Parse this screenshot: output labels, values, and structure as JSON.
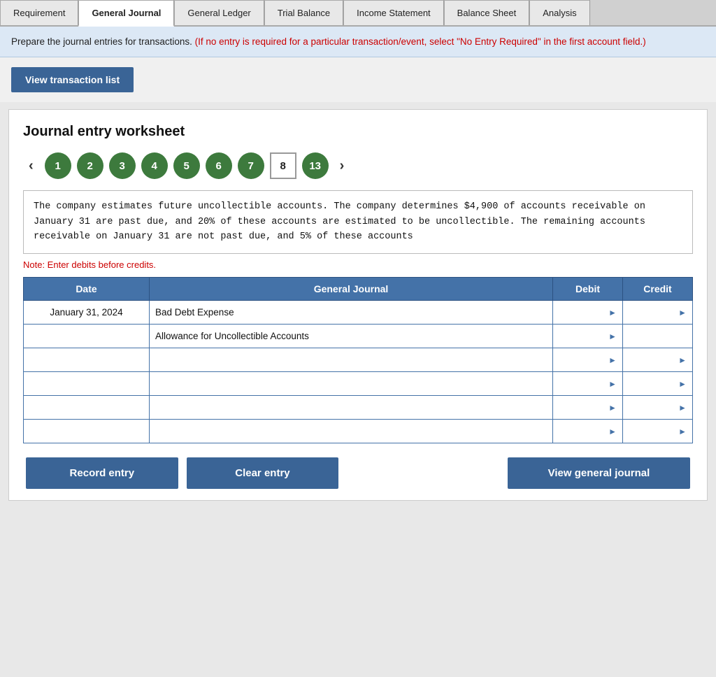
{
  "tabs": [
    {
      "id": "requirement",
      "label": "Requirement",
      "active": false
    },
    {
      "id": "general-journal",
      "label": "General\nJournal",
      "active": true
    },
    {
      "id": "general-ledger",
      "label": "General\nLedger",
      "active": false
    },
    {
      "id": "trial-balance",
      "label": "Trial Balance",
      "active": false
    },
    {
      "id": "income-statement",
      "label": "Income\nStatement",
      "active": false
    },
    {
      "id": "balance-sheet",
      "label": "Balance Sheet",
      "active": false
    },
    {
      "id": "analysis",
      "label": "Analysis",
      "active": false
    }
  ],
  "instruction": {
    "main": "Prepare the journal entries for transactions.",
    "red": " (If no entry is required for a particular transaction/event, select \"No Entry Required\" in the first account field.)"
  },
  "view_transaction_button": "View transaction list",
  "worksheet": {
    "title": "Journal entry worksheet",
    "nav_items": [
      1,
      2,
      3,
      4,
      5,
      6,
      7,
      8,
      13
    ],
    "active_item": 8,
    "scenario": "The company estimates future uncollectible accounts. The company determines $4,900 of accounts receivable on January 31 are past due, and 20% of these accounts are estimated to be uncollectible. The remaining accounts receivable on January 31 are not past due, and 5% of these accounts",
    "note": "Note: Enter debits before credits.",
    "table": {
      "headers": [
        "Date",
        "General Journal",
        "Debit",
        "Credit"
      ],
      "rows": [
        {
          "date": "January 31, 2024",
          "journal": "Bad Debt Expense",
          "indent": false,
          "debit": "",
          "credit": "",
          "debit_arrow": true,
          "credit_arrow": true
        },
        {
          "date": "",
          "journal": "Allowance for Uncollectible Accounts",
          "indent": true,
          "debit": "",
          "credit": "",
          "debit_arrow": true,
          "credit_dashed": true
        },
        {
          "date": "",
          "journal": "",
          "indent": false,
          "debit": "",
          "credit": "",
          "debit_arrow": true,
          "credit_arrow": true
        },
        {
          "date": "",
          "journal": "",
          "indent": false,
          "debit": "",
          "credit": "",
          "debit_arrow": true,
          "credit_arrow": true
        },
        {
          "date": "",
          "journal": "",
          "indent": false,
          "debit": "",
          "credit": "",
          "debit_arrow": true,
          "credit_arrow": true
        },
        {
          "date": "",
          "journal": "",
          "indent": false,
          "debit": "",
          "credit": "",
          "debit_arrow": true,
          "credit_arrow": true
        }
      ]
    }
  },
  "buttons": {
    "record": "Record entry",
    "clear": "Clear entry",
    "view_journal": "View general journal"
  }
}
